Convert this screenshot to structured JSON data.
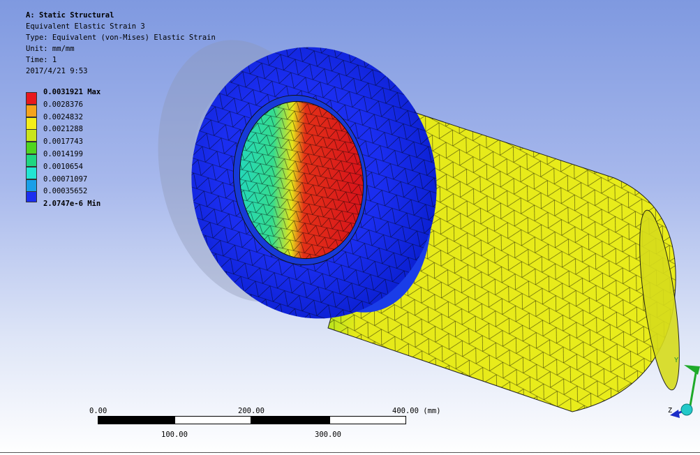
{
  "header": {
    "title": "A: Static Structural",
    "result_name": "Equivalent Elastic Strain 3",
    "type": "Type: Equivalent (von-Mises) Elastic Strain",
    "unit": "Unit: mm/mm",
    "time": "Time: 1",
    "date": "2017/4/21 9:53"
  },
  "legend": {
    "entries": [
      {
        "value": "0.0031921 Max",
        "color": "#e8171d",
        "bold": true
      },
      {
        "value": "0.0028376",
        "color": "#f5a31b"
      },
      {
        "value": "0.0024832",
        "color": "#f4ee1a"
      },
      {
        "value": "0.0021288",
        "color": "#c9e41a"
      },
      {
        "value": "0.0017743",
        "color": "#4fd51f"
      },
      {
        "value": "0.0014199",
        "color": "#1fd681"
      },
      {
        "value": "0.0010654",
        "color": "#22e5d3"
      },
      {
        "value": "0.00071097",
        "color": "#199fe8"
      },
      {
        "value": "0.00035652",
        "color": "#1b2ef0"
      },
      {
        "value": "2.0747e-6 Min",
        "color": "#1b2ef0",
        "bold": true
      }
    ]
  },
  "scale_bar": {
    "top_labels": [
      "0.00",
      "200.00",
      "400.00 (mm)"
    ],
    "bottom_labels": [
      "100.00",
      "300.00"
    ]
  },
  "triad": {
    "y_label": "Y",
    "z_label": "Z"
  }
}
